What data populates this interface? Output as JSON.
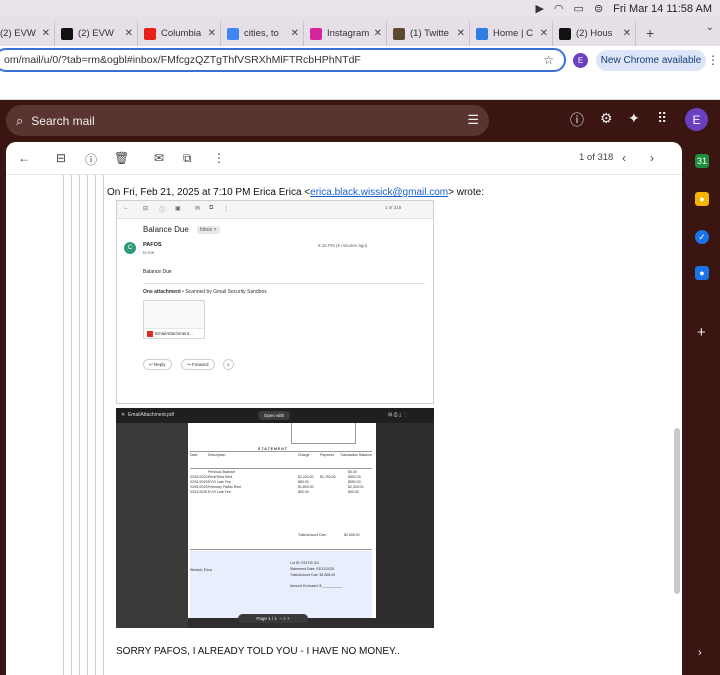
{
  "menubar": {
    "datetime": "Fri Mar 14  11:58 AM"
  },
  "tabs": [
    {
      "label": "(2) EVW",
      "icon": "globe-icon",
      "color": "#888888"
    },
    {
      "label": "(2) EVW",
      "icon": "x-logo-icon",
      "color": "#111111"
    },
    {
      "label": "Columbia",
      "icon": "youtube-icon",
      "color": "#e62117"
    },
    {
      "label": "cities, to",
      "icon": "google-icon",
      "color": "#4285f4"
    },
    {
      "label": "Instagram",
      "icon": "instagram-icon",
      "color": "#d6249f"
    },
    {
      "label": "(1) Twitte",
      "icon": "bird-icon",
      "color": "#5b4a2d"
    },
    {
      "label": "Home | C",
      "icon": "home-icon",
      "color": "#2f7de1"
    },
    {
      "label": "(2) Hous",
      "icon": "x-logo-icon",
      "color": "#111111"
    }
  ],
  "address": {
    "url": "om/mail/u/0/?tab=rm&ogbl#inbox/FMfcgzQZTgThfVSRXhMlFTRcbHPhNTdF",
    "profile_initial": "E",
    "new_chrome": "New Chrome available"
  },
  "gmail": {
    "search_placeholder": "Search mail",
    "avatar": "E",
    "pager": "1 of 318"
  },
  "message": {
    "intro": "On Fri, Feb 21, 2025 at 7:10 PM Erica Erica <",
    "email": "erica.black.wissick@gmail.com",
    "intro_end": "> wrote:",
    "reply": "SORRY PAFOS, I ALREADY TOLD YOU - I HAVE NO MONEY.."
  },
  "shot1": {
    "counter": "1 of 318",
    "subject": "Balance Due",
    "inbox": "Inbox ×",
    "sender_initial": "C",
    "sender": "PAFOS",
    "to": "to me",
    "time": "6:16 PM (8 minutes ago)",
    "body": "Balance Due",
    "attach_title": "One attachment",
    "attach_note": " • Scanned by Gmail Security Sandbox",
    "attach_name": "EmailAttachment...",
    "reply_btn": "Reply",
    "forward_btn": "Forward"
  },
  "shot2": {
    "title": "EmailAttachment.pdf",
    "open_with": "Open with",
    "statement": "STATEMENT",
    "col_date": "Date",
    "col_desc": "Description",
    "col_charge": "Charge",
    "col_payment": "Payment",
    "col_balance": "Transaction Balance",
    "rows": [
      {
        "date": "",
        "desc": "Previous Balance",
        "charge": "",
        "payment": "",
        "balance": "$0.00"
      },
      {
        "date": "02/01/2024",
        "desc": "Rent/Yeka Rent",
        "charge": "$2,220.00",
        "payment": "$1,750.00",
        "balance": "$500.00"
      },
      {
        "date": "02/01/2025",
        "desc": "EVVI Late Fee",
        "charge": "$50.00",
        "payment": "",
        "balance": "$550.00"
      },
      {
        "date": "03/01/2025",
        "desc": "February Paffas Rent",
        "charge": "$1,800.00",
        "payment": "",
        "balance": "$2,300.00"
      },
      {
        "date": "03/11/2025",
        "desc": "EVVI Late Fee",
        "charge": "$50.00",
        "payment": "",
        "balance": "$50.00"
      }
    ],
    "total_label": "Total Amount Due:",
    "total": "$2,808.00",
    "lot_id": "Lot ID:  PAFOS 3/4",
    "stmt_date": "Statement Date:  03/31/2025",
    "amount_due": "Total Amount Due:  $2,808.00",
    "amount_enclosed": "Amount Enclosed: $ __________",
    "tenant": "Wissick, Erica",
    "page": "Page  1 / 1"
  }
}
